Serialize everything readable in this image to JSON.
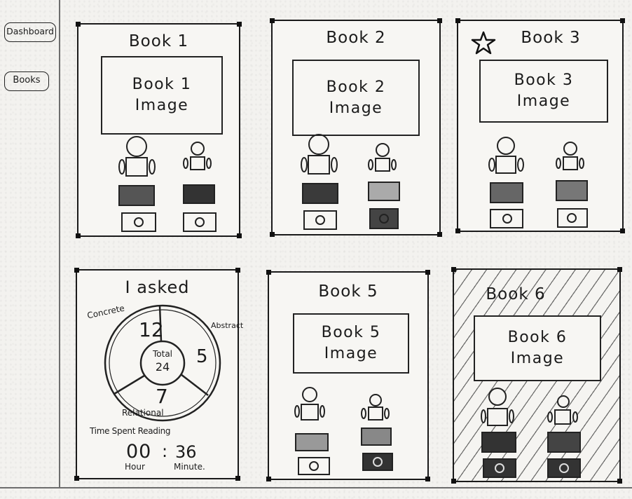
{
  "sidebar": {
    "items": [
      {
        "label": "Dashboard"
      },
      {
        "label": "Books"
      }
    ]
  },
  "books": [
    {
      "title": "Book 1",
      "image_label": "Book 1\nImage",
      "starred": false
    },
    {
      "title": "Book 2",
      "image_label": "Book 2\nImage",
      "starred": false
    },
    {
      "title": "Book 3",
      "image_label": "Book 3\nImage",
      "starred": true
    },
    {
      "title": "Book 5",
      "image_label": "Book 5\nImage",
      "starred": false
    },
    {
      "title": "Book 6",
      "image_label": "Book 6\nImage",
      "starred": false
    }
  ],
  "stats": {
    "title": "I asked",
    "labels": {
      "concrete": "Concrete",
      "abstract": "Abstract",
      "relational": "Relational"
    },
    "values": {
      "concrete": "12",
      "abstract": "5",
      "relational": "7"
    },
    "total_label": "Total",
    "total_value": "24",
    "time_label": "Time Spent Reading",
    "hours": "00",
    "minutes": "36",
    "separator": ":",
    "hour_label": "Hour",
    "minute_label": "Minute."
  }
}
